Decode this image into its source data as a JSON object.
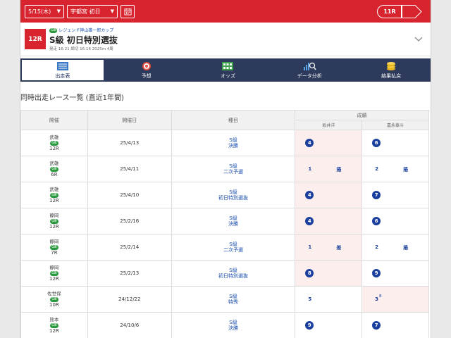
{
  "topbar": {
    "date_select": "5/15(木)",
    "meeting_select": "宇都宮 初日",
    "calendar_icon": "calendar-icon",
    "race_nav_label": "11R",
    "next_icon": "chevron-right-icon",
    "colors": {
      "bar": "#d7242e"
    }
  },
  "race": {
    "badge": "12R",
    "grade": "GⅢ",
    "cup_name": "レジェンド神山雄一郎カップ",
    "title": "S級 初日特別選抜",
    "meta": "発走 16:21 締切 16:16 2025m 4周",
    "expand_icon": "chevron-down-icon"
  },
  "tabs": [
    {
      "label": "出走表",
      "icon": "racecard-icon",
      "active": true
    },
    {
      "label": "予想",
      "icon": "target-icon",
      "active": false
    },
    {
      "label": "オッズ",
      "icon": "odds-board-icon",
      "active": false
    },
    {
      "label": "データ分析",
      "icon": "chart-magnifier-icon",
      "active": false
    },
    {
      "label": "結果払戻",
      "icon": "coins-icon",
      "active": false
    }
  ],
  "section_title": "同時出走レース一覧 (直近1年間)",
  "table": {
    "headers": {
      "venue": "開催",
      "date": "開催日",
      "event": "種目",
      "result": "成績",
      "rider1": "坂井洋",
      "rider2": "嘉永泰斗"
    },
    "rows": [
      {
        "venue": "武雄",
        "grade": "GⅢ",
        "race": "12R",
        "date": "25/4/13",
        "class": "S級",
        "event": "決勝",
        "r1": {
          "rank": "4",
          "style": "circle",
          "note": "",
          "sup": "",
          "pink": true
        },
        "r2": {
          "rank": "6",
          "style": "circle",
          "note": "",
          "sup": "",
          "pink": false
        }
      },
      {
        "venue": "武雄",
        "grade": "GⅢ",
        "race": "6R",
        "date": "25/4/11",
        "class": "S級",
        "event": "二次予選",
        "r1": {
          "rank": "1",
          "style": "plain",
          "note": "捲",
          "sup": "",
          "pink": true
        },
        "r2": {
          "rank": "2",
          "style": "plain",
          "note": "捲",
          "sup": "",
          "pink": false
        }
      },
      {
        "venue": "武雄",
        "grade": "GⅢ",
        "race": "12R",
        "date": "25/4/10",
        "class": "S級",
        "event": "初日特別選抜",
        "r1": {
          "rank": "4",
          "style": "circle",
          "note": "",
          "sup": "",
          "pink": true
        },
        "r2": {
          "rank": "7",
          "style": "circle",
          "note": "",
          "sup": "",
          "pink": false
        }
      },
      {
        "venue": "静岡",
        "grade": "GⅢ",
        "race": "12R",
        "date": "25/2/16",
        "class": "S級",
        "event": "決勝",
        "r1": {
          "rank": "4",
          "style": "circle",
          "note": "",
          "sup": "",
          "pink": true
        },
        "r2": {
          "rank": "6",
          "style": "circle",
          "note": "",
          "sup": "",
          "pink": false
        }
      },
      {
        "venue": "静岡",
        "grade": "GⅢ",
        "race": "7R",
        "date": "25/2/14",
        "class": "S級",
        "event": "二次予選",
        "r1": {
          "rank": "1",
          "style": "plain",
          "note": "差",
          "sup": "",
          "pink": true
        },
        "r2": {
          "rank": "2",
          "style": "plain",
          "note": "捲",
          "sup": "",
          "pink": false
        }
      },
      {
        "venue": "静岡",
        "grade": "GⅢ",
        "race": "12R",
        "date": "25/2/13",
        "class": "S級",
        "event": "初日特別選抜",
        "r1": {
          "rank": "8",
          "style": "circle",
          "note": "",
          "sup": "",
          "pink": true
        },
        "r2": {
          "rank": "9",
          "style": "circle",
          "note": "",
          "sup": "",
          "pink": false
        }
      },
      {
        "venue": "佐世保",
        "grade": "GⅢ",
        "race": "10R",
        "date": "24/12/22",
        "class": "S級",
        "event": "特秀",
        "r1": {
          "rank": "5",
          "style": "plain",
          "note": "",
          "sup": "",
          "pink": false
        },
        "r2": {
          "rank": "3",
          "style": "plain",
          "note": "",
          "sup": "B",
          "pink": true
        }
      },
      {
        "venue": "熊本",
        "grade": "GⅢ",
        "race": "12R",
        "date": "24/10/6",
        "class": "S級",
        "event": "決勝",
        "r1": {
          "rank": "9",
          "style": "circle",
          "note": "",
          "sup": "",
          "pink": false
        },
        "r2": {
          "rank": "7",
          "style": "circle",
          "note": "",
          "sup": "",
          "pink": false
        }
      }
    ]
  }
}
